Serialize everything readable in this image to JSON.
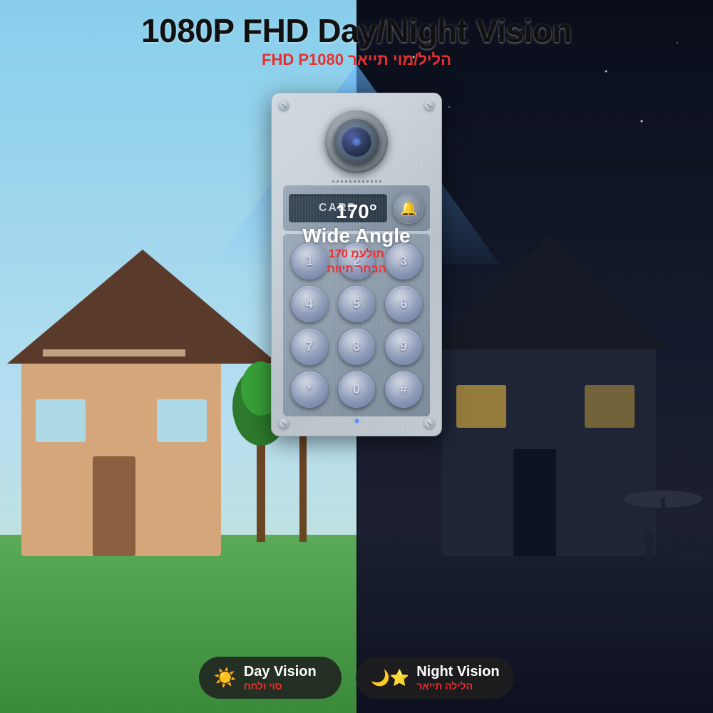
{
  "header": {
    "title": "1080P FHD Day/Night Vision",
    "subtitle_he": "הליל/מוי תייאר FHD P1080"
  },
  "camera": {
    "angle_en": "170°\nWide Angle",
    "angle_degrees": "170°",
    "angle_label": "Wide Angle",
    "angle_he_line1": "תולעמ 170",
    "angle_he_line2": "הבחר תיוות"
  },
  "card_reader": {
    "label": "CARD"
  },
  "keypad": {
    "keys": [
      "1",
      "2",
      "3",
      "4",
      "5",
      "6",
      "7",
      "8",
      "9",
      "*",
      "0",
      "#"
    ]
  },
  "badges": {
    "day": {
      "title": "Day Vision",
      "subtitle": "סוי ולחח",
      "icon": "☀"
    },
    "night": {
      "title": "Night Vision",
      "subtitle": "הלילה תייאר",
      "icon": "🌙"
    }
  }
}
